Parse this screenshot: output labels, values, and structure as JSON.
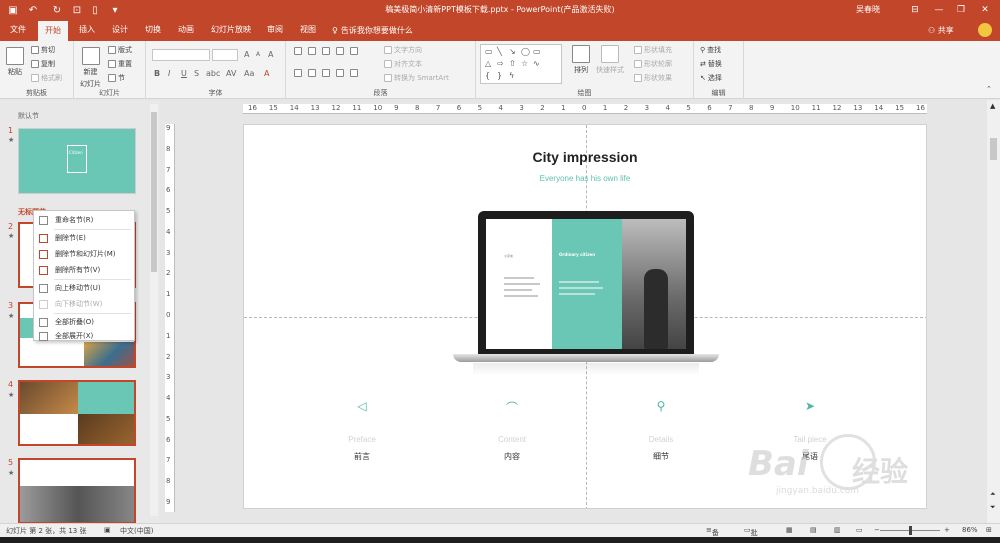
{
  "window": {
    "title": "稿美极简小清新PPT模板下载.pptx  -  PowerPoint(产品激活失败)",
    "user": "吴春晓",
    "brand_color": "#c1462a"
  },
  "tabs": [
    "文件",
    "开始",
    "插入",
    "设计",
    "切换",
    "动画",
    "幻灯片放映",
    "审阅",
    "视图"
  ],
  "active_tab": "开始",
  "tell_me": "告诉我你想要做什么",
  "share": "共享",
  "ribbon": {
    "clipboard": {
      "paste": "粘贴",
      "cut": "剪切",
      "copy": "复制",
      "format_painter": "格式刷",
      "label": "剪贴板"
    },
    "slides": {
      "new_slide": "新建",
      "new_slide2": "幻灯片",
      "layout": "版式",
      "reset": "重置",
      "section": "节",
      "label": "幻灯片"
    },
    "font": {
      "label": "字体",
      "size_up": "A",
      "size_down": "A",
      "bold": "B",
      "italic": "I",
      "underline": "U",
      "strike": "S",
      "shadow": "abc",
      "spacing": "AV",
      "case": "Aa",
      "color": "A",
      "clear": "A"
    },
    "paragraph": {
      "label": "段落",
      "text_direction": "文字方向",
      "align_text": "对齐文本",
      "smartart": "转换为 SmartArt"
    },
    "drawing": {
      "label": "绘图",
      "arrange": "排列",
      "quick_styles": "快速样式",
      "shape_fill": "形状填充",
      "shape_outline": "形状轮廓",
      "shape_effects": "形状效果"
    },
    "editing": {
      "label": "编辑",
      "find": "查找",
      "replace": "替换",
      "select": "选择"
    }
  },
  "thumbnails": {
    "section_default": "默认节",
    "section_untitled": "无标题节",
    "numbers": [
      "1",
      "2",
      "3",
      "4",
      "5"
    ],
    "star": "★",
    "slide1_title": "Citizen",
    "accent": "#6ac7b5"
  },
  "context_menu": {
    "items": [
      {
        "label": "重命名节(R)",
        "enabled": true
      },
      {
        "label": "删除节(E)",
        "enabled": true
      },
      {
        "label": "删除节和幻灯片(M)",
        "enabled": true
      },
      {
        "label": "删除所有节(V)",
        "enabled": true
      },
      {
        "label": "向上移动节(U)",
        "enabled": true
      },
      {
        "label": "向下移动节(W)",
        "enabled": false
      },
      {
        "label": "全部折叠(O)",
        "enabled": true
      },
      {
        "label": "全部展开(X)",
        "enabled": true
      }
    ]
  },
  "ruler": {
    "h_ticks": [
      "16",
      "15",
      "14",
      "13",
      "12",
      "11",
      "10",
      "9",
      "8",
      "7",
      "6",
      "5",
      "4",
      "3",
      "2",
      "1",
      "0",
      "1",
      "2",
      "3",
      "4",
      "5",
      "6",
      "7",
      "8",
      "9",
      "10",
      "11",
      "12",
      "13",
      "14",
      "15",
      "16"
    ],
    "v_ticks": [
      "9",
      "8",
      "7",
      "6",
      "5",
      "4",
      "3",
      "2",
      "1",
      "0",
      "1",
      "2",
      "3",
      "4",
      "5",
      "6",
      "7",
      "8",
      "9"
    ]
  },
  "slide": {
    "title": "City impression",
    "subtitle": "Everyone has his own life",
    "screen_title": "Ordinary citizen",
    "screen_label": "小序言",
    "accent": "#5fbfae",
    "columns": [
      {
        "icon": "paper-plane-icon",
        "glyph": "◁",
        "en": "Preface",
        "cn": "前言"
      },
      {
        "icon": "arch-icon",
        "glyph": "⌒",
        "en": "Content",
        "cn": "内容"
      },
      {
        "icon": "search-icon",
        "glyph": "⚲",
        "en": "Details",
        "cn": "细节"
      },
      {
        "icon": "navigation-icon",
        "glyph": "➤",
        "en": "Tail piece",
        "cn": "尾语"
      }
    ]
  },
  "status": {
    "slide_info": "幻灯片 第 2 张，共 13 张",
    "language": "中文(中国)",
    "notes": "备注",
    "comments": "批注",
    "zoom": "86%"
  },
  "watermark": {
    "text1": "Bai",
    "text2": "经验",
    "url": "jingyan.baidu.com"
  }
}
